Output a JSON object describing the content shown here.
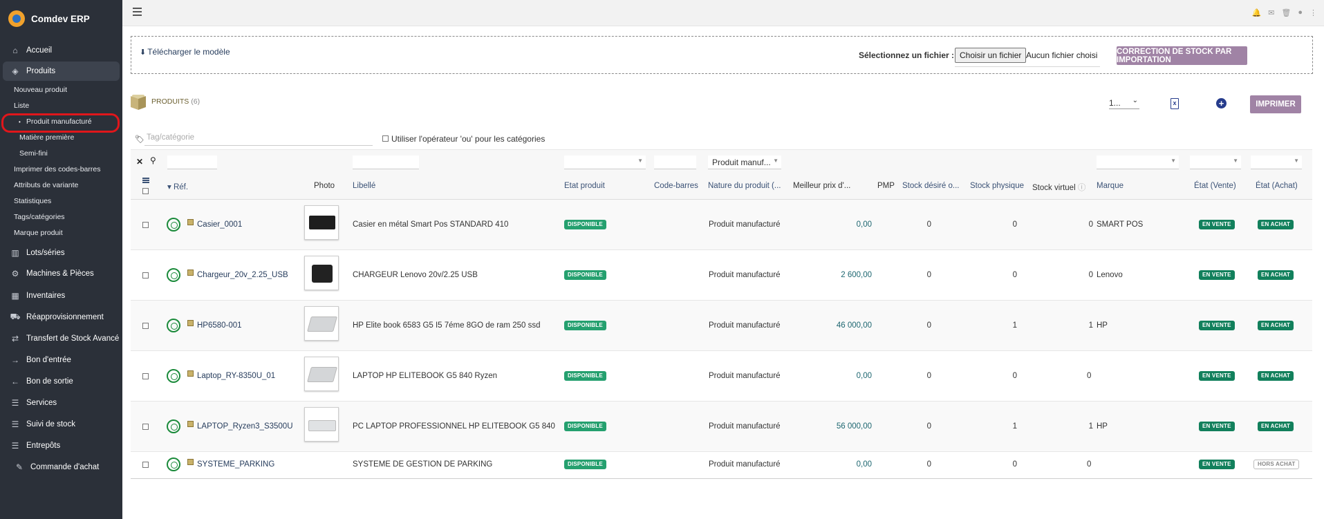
{
  "app": {
    "name": "Comdev ERP"
  },
  "sidebar": {
    "items": [
      {
        "label": "Accueil",
        "icon": "home-icon"
      },
      {
        "label": "Produits",
        "icon": "box-icon"
      },
      {
        "label": "Lots/séries",
        "icon": "barcode-icon"
      },
      {
        "label": "Machines & Pièces",
        "icon": "cogs-icon"
      },
      {
        "label": "Inventaires",
        "icon": "boxes-icon"
      },
      {
        "label": "Réapprovisionnement",
        "icon": "truck-icon"
      },
      {
        "label": "Transfert de Stock Avancé",
        "icon": "transfer-icon"
      },
      {
        "label": "Bon d'entrée",
        "icon": "arrow-right-icon"
      },
      {
        "label": "Bon de sortie",
        "icon": "arrow-left-icon"
      },
      {
        "label": "Services",
        "icon": "services-icon"
      },
      {
        "label": "Suivi de stock",
        "icon": "stock-icon"
      },
      {
        "label": "Entrepôts",
        "icon": "warehouse-icon"
      },
      {
        "label": "Commande d'achat",
        "icon": "order-icon"
      }
    ],
    "sub": {
      "nouveau": "Nouveau produit",
      "liste": "Liste",
      "produit_manufacture": "Produit manufacturé",
      "matiere_premiere": "Matière première",
      "semi_fini": "Semi-fini",
      "codes_barres": "Imprimer des codes-barres",
      "attributs": "Attributs de variante",
      "statistiques": "Statistiques",
      "tags": "Tags/catégories",
      "marque": "Marque produit"
    }
  },
  "import": {
    "download_label": "Télécharger le modèle",
    "file_label": "Sélectionnez un fichier :",
    "file_button": "Choisir un fichier",
    "file_status": "Aucun fichier choisi",
    "correction_button": "CORRECTION DE STOCK PAR IMPORTATION"
  },
  "list": {
    "title": "PRODUITS",
    "count": "(6)",
    "pager": "1...",
    "print_button": "IMPRIMER",
    "tag_placeholder": "Tag/catégorie",
    "or_label": "Utiliser l'opérateur 'ou' pour les catégories",
    "nature_filter": "Produit manuf..."
  },
  "table": {
    "headers": {
      "ref": "Réf.",
      "photo": "Photo",
      "libelle": "Libellé",
      "etat_produit": "Etat produit",
      "code_barres": "Code-barres",
      "nature": "Nature du produit (...",
      "meilleur_prix": "Meilleur prix d'...",
      "pmp": "PMP",
      "stock_desire": "Stock désiré o...",
      "stock_physique": "Stock physique",
      "stock_virtuel": "Stock virtuel",
      "marque": "Marque",
      "etat_vente": "État (Vente)",
      "etat_achat": "État (Achat)"
    },
    "rows": [
      {
        "ref": "Casier_0001",
        "libelle": "Casier en métal Smart Pos STANDARD 410",
        "etat": "DISPONIBLE",
        "nature": "Produit manufacturé",
        "pmp": "0,00",
        "stock_desire": "0",
        "stock_physique": "0",
        "stock_virtuel": "0",
        "marque": "SMART POS",
        "vente": "EN VENTE",
        "achat": "EN ACHAT"
      },
      {
        "ref": "Chargeur_20v_2.25_USB",
        "libelle": "CHARGEUR Lenovo 20v/2.25 USB",
        "etat": "DISPONIBLE",
        "nature": "Produit manufacturé",
        "pmp": "2 600,00",
        "stock_desire": "0",
        "stock_physique": "0",
        "stock_virtuel": "0",
        "marque": "Lenovo",
        "vente": "EN VENTE",
        "achat": "EN ACHAT"
      },
      {
        "ref": "HP6580-001",
        "libelle": "HP Elite book 6583 G5 I5 7éme 8GO de ram 250 ssd",
        "etat": "DISPONIBLE",
        "nature": "Produit manufacturé",
        "pmp": "46 000,00",
        "stock_desire": "0",
        "stock_physique": "1",
        "stock_virtuel": "1",
        "marque": "HP",
        "vente": "EN VENTE",
        "achat": "EN ACHAT"
      },
      {
        "ref": "Laptop_RY-8350U_01",
        "libelle": "LAPTOP HP ELITEBOOK G5 840 Ryzen",
        "etat": "DISPONIBLE",
        "nature": "Produit manufacturé",
        "pmp": "0,00",
        "stock_desire": "0",
        "stock_physique": "0",
        "stock_virtuel": "0",
        "marque": "",
        "vente": "EN VENTE",
        "achat": "EN ACHAT"
      },
      {
        "ref": "LAPTOP_Ryzen3_S3500U",
        "libelle": "PC LAPTOP PROFESSIONNEL HP ELITEBOOK G5 840",
        "etat": "DISPONIBLE",
        "nature": "Produit manufacturé",
        "pmp": "56 000,00",
        "stock_desire": "0",
        "stock_physique": "1",
        "stock_virtuel": "1",
        "marque": "HP",
        "vente": "EN VENTE",
        "achat": "EN ACHAT"
      },
      {
        "ref": "SYSTEME_PARKING",
        "libelle": "SYSTEME DE GESTION DE PARKING",
        "etat": "DISPONIBLE",
        "nature": "Produit manufacturé",
        "pmp": "0,00",
        "stock_desire": "0",
        "stock_physique": "0",
        "stock_virtuel": "0",
        "marque": "",
        "vente": "EN VENTE",
        "achat": "HORS ACHAT"
      }
    ]
  },
  "colors": {
    "sidebar_bg": "#2b3039",
    "accent_purple": "#a083a5",
    "badge_green": "#25a06f",
    "link_blue": "#263c5c"
  }
}
